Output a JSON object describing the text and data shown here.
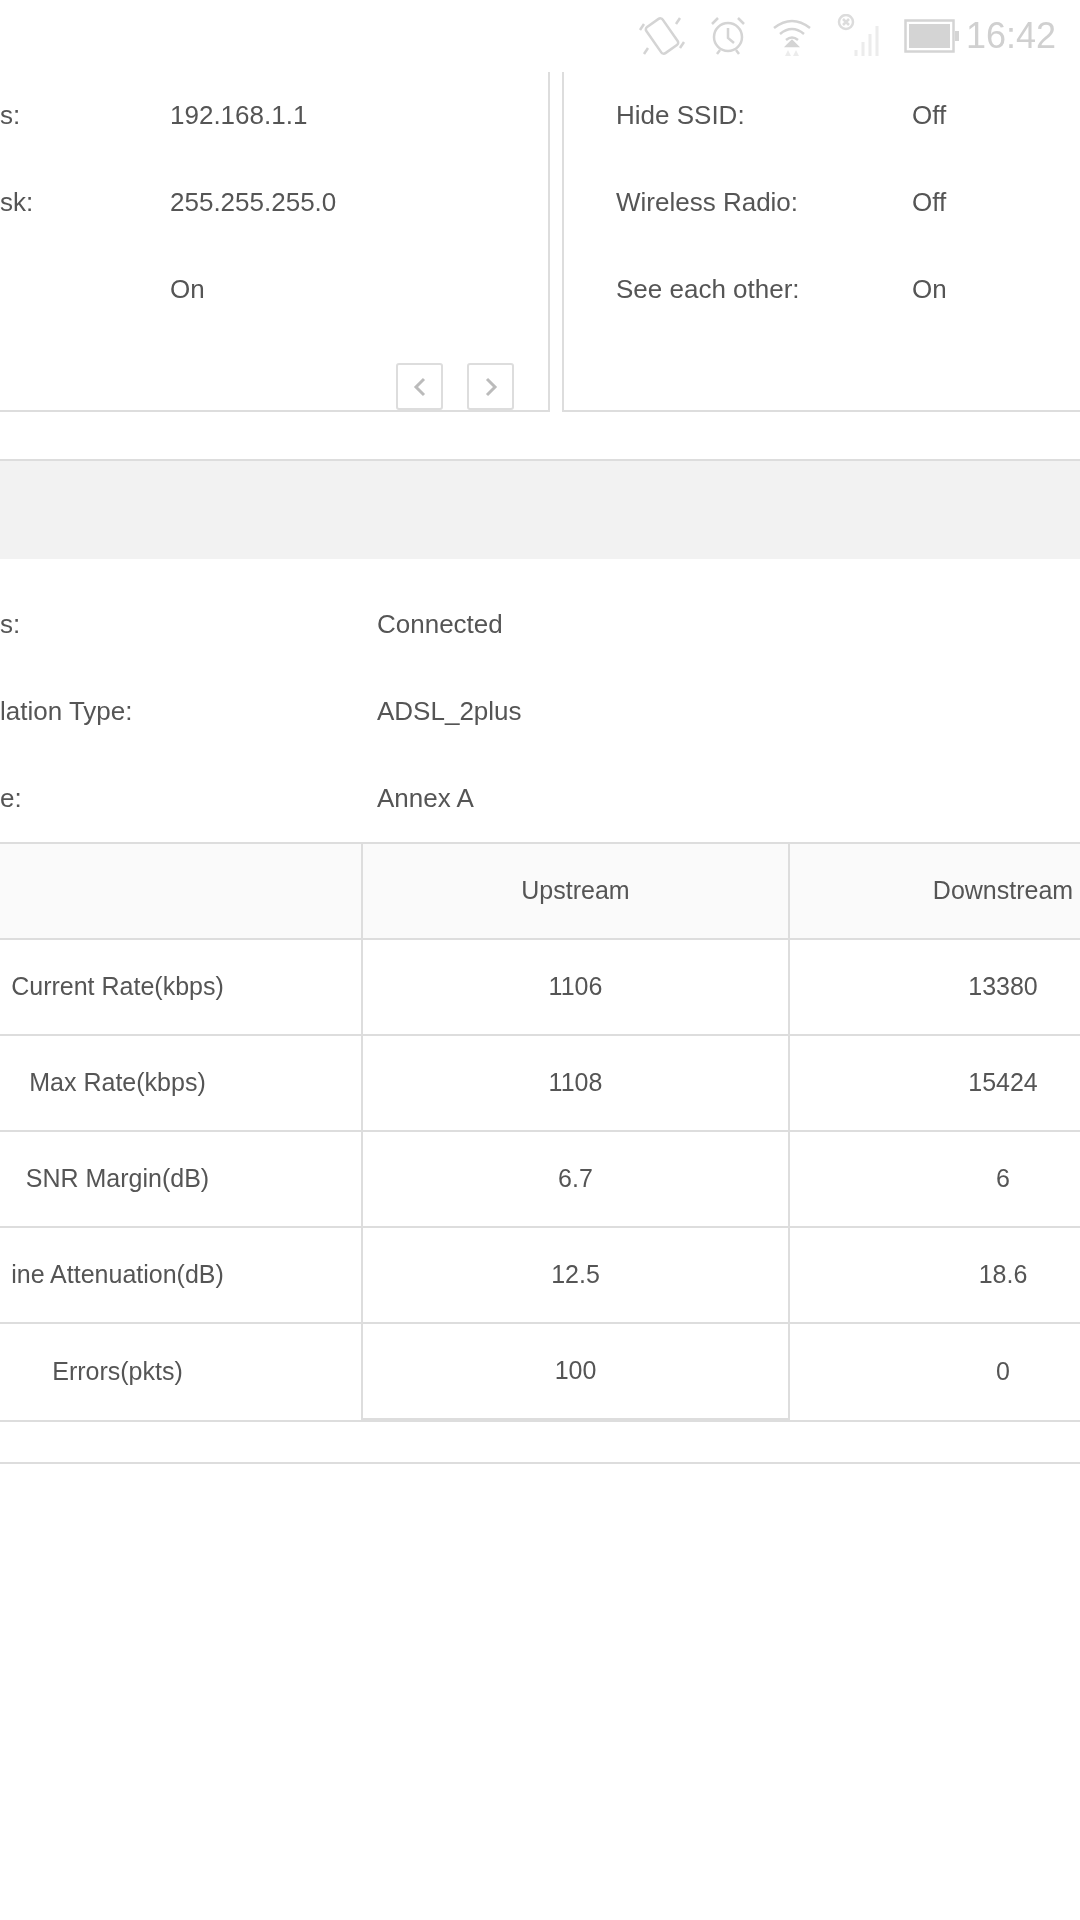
{
  "status_bar": {
    "time": "16:42"
  },
  "lan_panel": {
    "rows": [
      {
        "label": "s:",
        "value": "192.168.1.1"
      },
      {
        "label": "sk:",
        "value": "255.255.255.0"
      },
      {
        "label": "",
        "value": "On"
      }
    ]
  },
  "wireless_panel": {
    "rows": [
      {
        "label": "Hide SSID:",
        "value": "Off"
      },
      {
        "label": "Wireless Radio:",
        "value": "Off"
      },
      {
        "label": "See each other:",
        "value": "On"
      }
    ]
  },
  "dsl_section": {
    "rows": [
      {
        "label": "s:",
        "value": "Connected"
      },
      {
        "label": "lation Type:",
        "value": "ADSL_2plus"
      },
      {
        "label": "e:",
        "value": "Annex A"
      }
    ],
    "table": {
      "columns": [
        "Upstream",
        "Downstream"
      ],
      "rows": [
        {
          "label": "Current Rate(kbps)",
          "upstream": "1106",
          "downstream": "13380"
        },
        {
          "label": "Max Rate(kbps)",
          "upstream": "1108",
          "downstream": "15424"
        },
        {
          "label": "SNR Margin(dB)",
          "upstream": "6.7",
          "downstream": "6"
        },
        {
          "label": "ine Attenuation(dB)",
          "upstream": "12.5",
          "downstream": "18.6"
        },
        {
          "label": "Errors(pkts)",
          "upstream": "100",
          "downstream": "0"
        }
      ]
    }
  }
}
